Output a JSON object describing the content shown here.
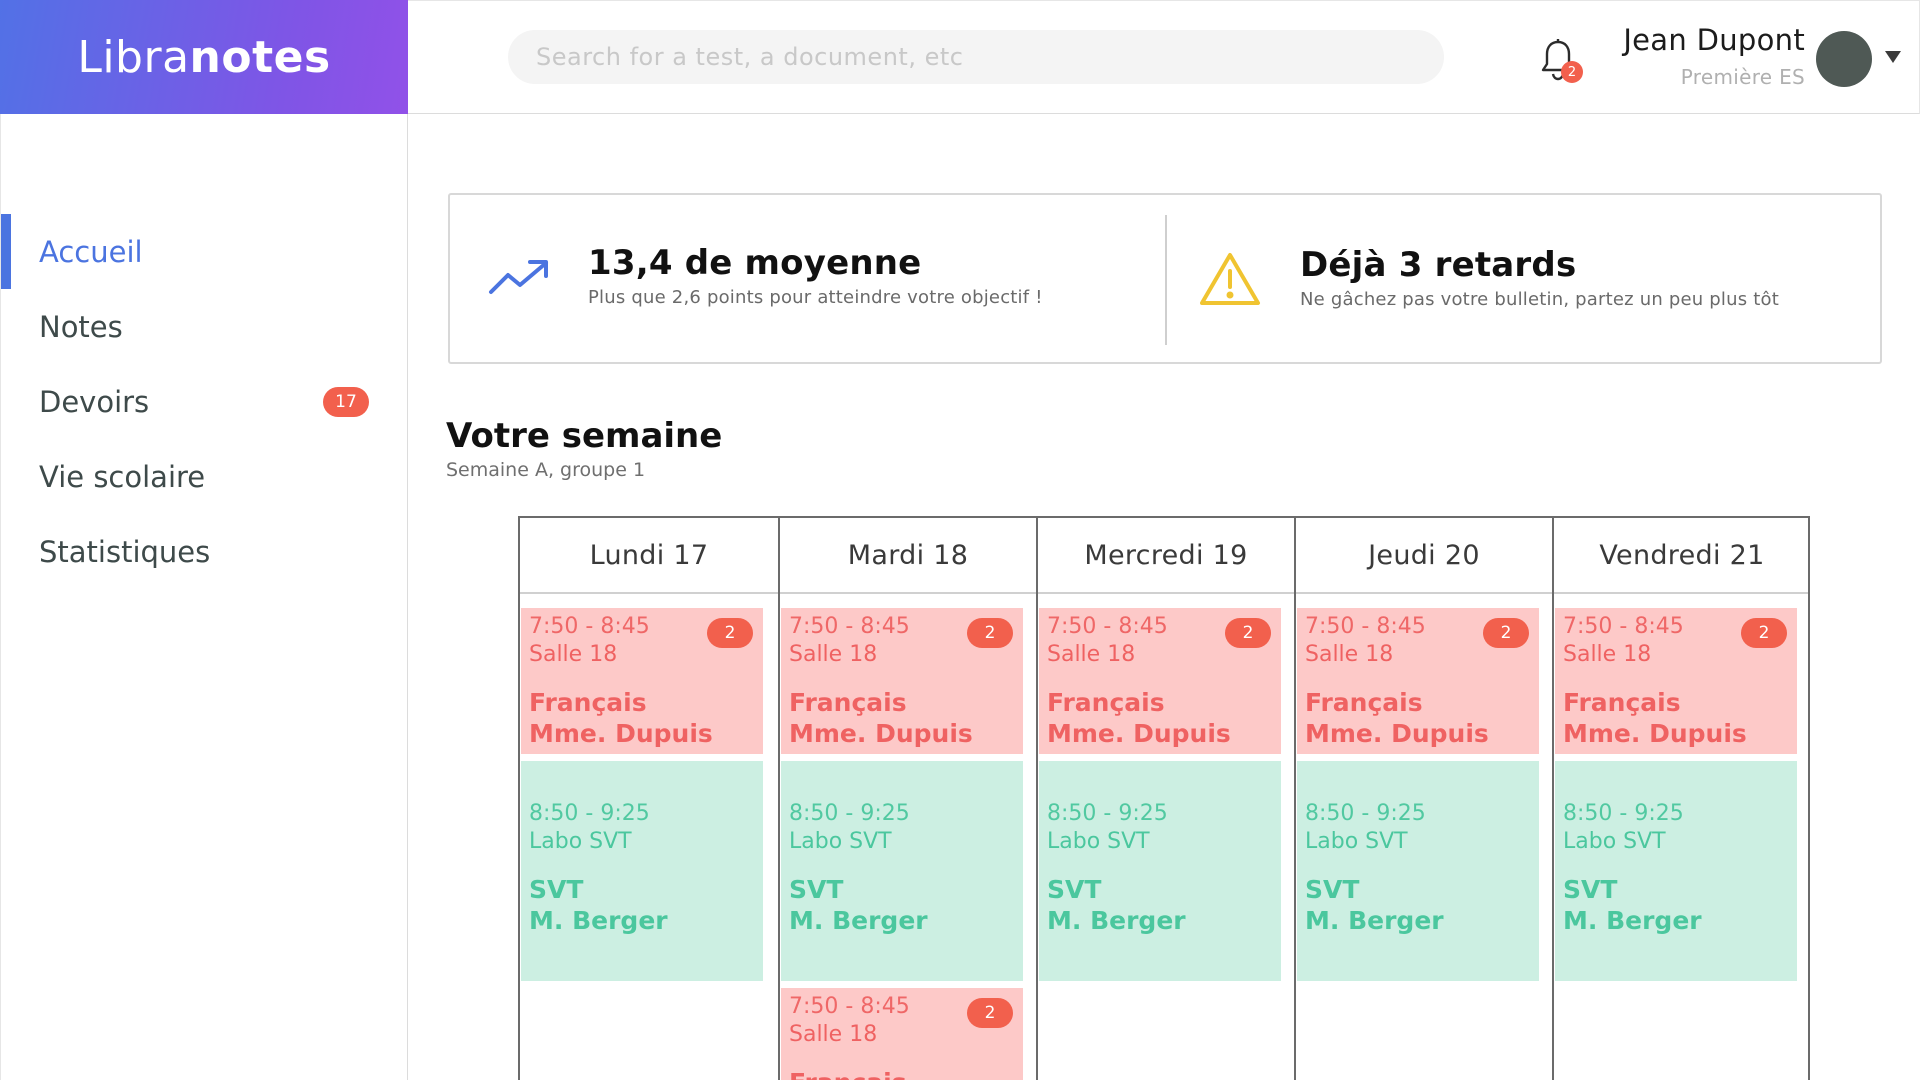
{
  "app": {
    "logo_light": "Libra",
    "logo_bold": "notes"
  },
  "header": {
    "search_placeholder": "Search for a test, a document, etc",
    "notification_count": "2",
    "user_name": "Jean Dupont",
    "user_class": "Première ES"
  },
  "sidebar": {
    "items": [
      {
        "label": "Accueil",
        "active": true
      },
      {
        "label": "Notes"
      },
      {
        "label": "Devoirs",
        "badge": "17"
      },
      {
        "label": "Vie scolaire"
      },
      {
        "label": "Statistiques"
      }
    ]
  },
  "stats": [
    {
      "icon": "trend-up-icon",
      "title": "13,4 de moyenne",
      "subtitle": "Plus que 2,6 points pour atteindre votre objectif !"
    },
    {
      "icon": "warning-icon",
      "title": "Déjà 3 retards",
      "subtitle": "Ne gâchez pas votre bulletin, partez un peu plus tôt"
    }
  ],
  "week": {
    "title": "Votre semaine",
    "subtitle": "Semaine A, groupe 1",
    "days": [
      {
        "label": "Lundi 17",
        "slots": [
          {
            "time": "7:50 - 8:45",
            "room": "Salle 18",
            "subject": "Français",
            "teacher": "Mme. Dupuis",
            "badge": "2",
            "color": "red"
          },
          {
            "time": "8:50 - 9:25",
            "room": "Labo SVT",
            "subject": "SVT",
            "teacher": "M. Berger",
            "color": "green"
          }
        ]
      },
      {
        "label": "Mardi 18",
        "slots": [
          {
            "time": "7:50 - 8:45",
            "room": "Salle 18",
            "subject": "Français",
            "teacher": "Mme. Dupuis",
            "badge": "2",
            "color": "red"
          },
          {
            "time": "8:50 - 9:25",
            "room": "Labo SVT",
            "subject": "SVT",
            "teacher": "M. Berger",
            "color": "green"
          },
          {
            "time": "7:50 - 8:45",
            "room": "Salle 18",
            "subject": "Français",
            "teacher": "",
            "badge": "2",
            "color": "red"
          }
        ]
      },
      {
        "label": "Mercredi 19",
        "slots": [
          {
            "time": "7:50 - 8:45",
            "room": "Salle 18",
            "subject": "Français",
            "teacher": "Mme. Dupuis",
            "badge": "2",
            "color": "red"
          },
          {
            "time": "8:50 - 9:25",
            "room": "Labo SVT",
            "subject": "SVT",
            "teacher": "M. Berger",
            "color": "green"
          }
        ]
      },
      {
        "label": "Jeudi 20",
        "slots": [
          {
            "time": "7:50 - 8:45",
            "room": "Salle 18",
            "subject": "Français",
            "teacher": "Mme. Dupuis",
            "badge": "2",
            "color": "red"
          },
          {
            "time": "8:50 - 9:25",
            "room": "Labo SVT",
            "subject": "SVT",
            "teacher": "M. Berger",
            "color": "green"
          }
        ]
      },
      {
        "label": "Vendredi 21",
        "slots": [
          {
            "time": "7:50 - 8:45",
            "room": "Salle 18",
            "subject": "Français",
            "teacher": "Mme. Dupuis",
            "badge": "2",
            "color": "red"
          },
          {
            "time": "8:50 - 9:25",
            "room": "Labo SVT",
            "subject": "SVT",
            "teacher": "M. Berger",
            "color": "green"
          }
        ]
      }
    ]
  },
  "colors": {
    "accent": "#4b74e0",
    "badge": "#f2604d",
    "slot_red_bg": "#fdc9c8",
    "slot_red_text": "#ef6262",
    "slot_green_bg": "#ccefe2",
    "slot_green_text": "#4bc79e",
    "warning": "#f0c431"
  }
}
